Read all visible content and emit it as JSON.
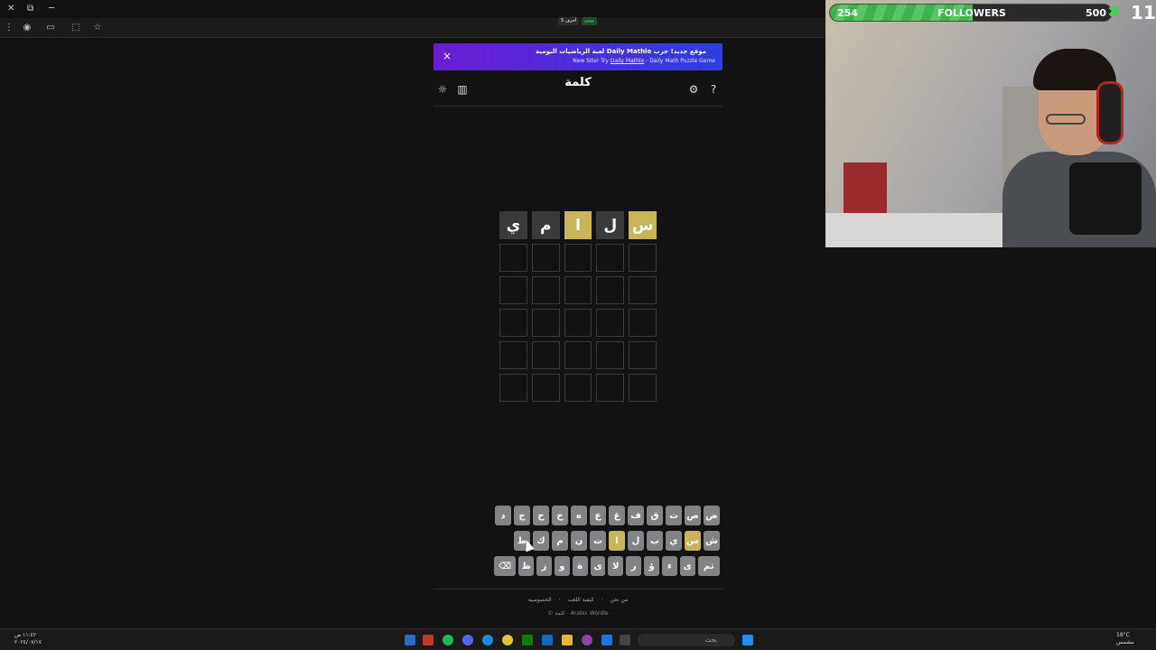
{
  "banner": {
    "close": "×",
    "line1": "موقع جديد! جرب Daily Mathle لعبة الرياضيات اليومية",
    "line2_prefix": "New Site! Try ",
    "line2_link": "Daily Mathle",
    "line2_suffix": " - Daily Math Puzzle Game"
  },
  "header": {
    "title": "كلمة",
    "letters_badge": "5 أحرف",
    "daily_badge": "يومي",
    "icons": [
      "help-icon",
      "settings-icon",
      "stats-icon",
      "theme-icon"
    ]
  },
  "board": {
    "rows": [
      [
        {
          "letter": "س",
          "state": "present"
        },
        {
          "letter": "ل",
          "state": "absent"
        },
        {
          "letter": "ا",
          "state": "present"
        },
        {
          "letter": "م",
          "state": "absent"
        },
        {
          "letter": "ي",
          "state": "absent"
        }
      ],
      [
        {
          "letter": "",
          "state": "empty"
        },
        {
          "letter": "",
          "state": "empty"
        },
        {
          "letter": "",
          "state": "empty"
        },
        {
          "letter": "",
          "state": "empty"
        },
        {
          "letter": "",
          "state": "empty"
        }
      ],
      [
        {
          "letter": "",
          "state": "empty"
        },
        {
          "letter": "",
          "state": "empty"
        },
        {
          "letter": "",
          "state": "empty"
        },
        {
          "letter": "",
          "state": "empty"
        },
        {
          "letter": "",
          "state": "empty"
        }
      ],
      [
        {
          "letter": "",
          "state": "empty"
        },
        {
          "letter": "",
          "state": "empty"
        },
        {
          "letter": "",
          "state": "empty"
        },
        {
          "letter": "",
          "state": "empty"
        },
        {
          "letter": "",
          "state": "empty"
        }
      ],
      [
        {
          "letter": "",
          "state": "empty"
        },
        {
          "letter": "",
          "state": "empty"
        },
        {
          "letter": "",
          "state": "empty"
        },
        {
          "letter": "",
          "state": "empty"
        },
        {
          "letter": "",
          "state": "empty"
        }
      ],
      [
        {
          "letter": "",
          "state": "empty"
        },
        {
          "letter": "",
          "state": "empty"
        },
        {
          "letter": "",
          "state": "empty"
        },
        {
          "letter": "",
          "state": "empty"
        },
        {
          "letter": "",
          "state": "empty"
        }
      ]
    ]
  },
  "keyboard": {
    "row1": [
      "ض",
      "ص",
      "ث",
      "ق",
      "ف",
      "غ",
      "ع",
      "ه",
      "خ",
      "ح",
      "ج",
      "د"
    ],
    "row2": [
      "ش",
      "س",
      "ي",
      "ب",
      "ل",
      "ا",
      "ت",
      "ن",
      "م",
      "ك",
      "ط"
    ],
    "row3": [
      "تم",
      "ى",
      "ء",
      "ؤ",
      "ر",
      "لا",
      "ى",
      "ة",
      "و",
      "ز",
      "ظ",
      "⌫"
    ],
    "present_keys": [
      "س",
      "ا"
    ]
  },
  "footer": {
    "links": [
      "من نحن",
      "كيفية اللعب",
      "الخصوصية"
    ],
    "copyright": "© كلمة - Arabic Wordle"
  },
  "stream": {
    "followers_label": "FOLLOWERS",
    "followers_current": "254",
    "followers_goal": "500",
    "followers_progress": 0.508,
    "counter": "11"
  },
  "taskbar": {
    "search_placeholder": "بحث",
    "time": "١١:٤٢ ص",
    "date": "٢٠٢٤/٠٧/١٧",
    "weather": "18°C",
    "weather_desc": "مشمس"
  },
  "colors": {
    "present": "#c9b458",
    "absent": "#3a3a3c",
    "key": "#818384",
    "background": "#121213"
  }
}
